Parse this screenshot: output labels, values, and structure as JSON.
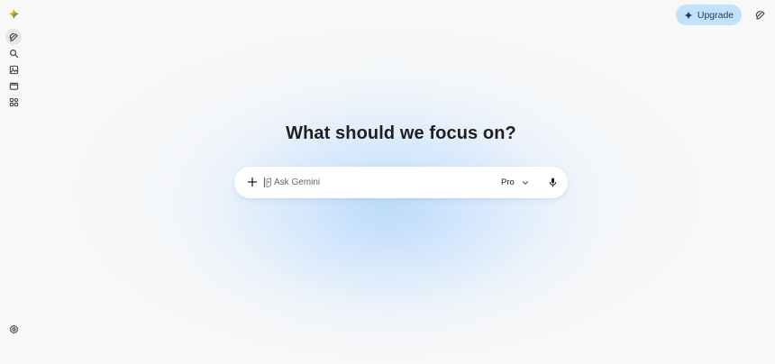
{
  "header": {
    "upgrade_label": "Upgrade"
  },
  "sidebar": {
    "items": [
      {
        "name": "new-chat",
        "icon": "edit-icon"
      },
      {
        "name": "search",
        "icon": "search-icon"
      },
      {
        "name": "gallery",
        "icon": "image-icon"
      },
      {
        "name": "videos",
        "icon": "video-icon"
      },
      {
        "name": "apps",
        "icon": "apps-icon"
      }
    ],
    "settings_icon": "gear-icon"
  },
  "main": {
    "heading": "What should we focus on?",
    "prompt": {
      "placeholder": "Ask Gemini",
      "model_label": "Pro"
    }
  },
  "colors": {
    "accent": "#c2e1fb",
    "background": "#f8f8f8",
    "glow": "#badafa"
  }
}
